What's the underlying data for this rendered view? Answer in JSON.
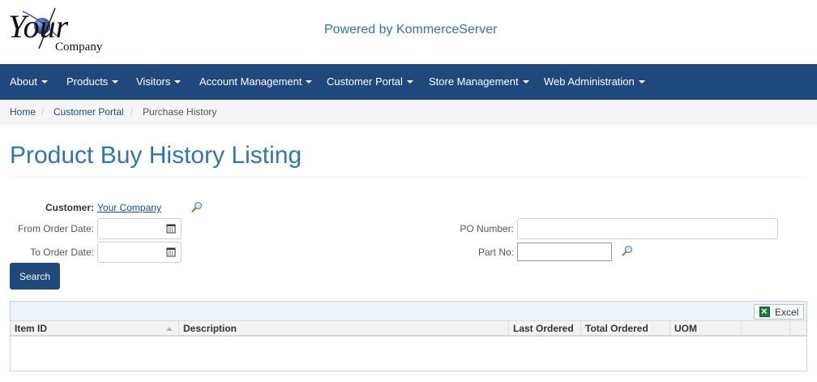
{
  "header": {
    "logo_text_main": "Your",
    "logo_text_sub": "Company",
    "powered_by": "Powered by KommerceServer"
  },
  "nav": {
    "items": [
      {
        "label": "About"
      },
      {
        "label": "Products"
      },
      {
        "label": "Visitors"
      },
      {
        "label": "Account Management"
      },
      {
        "label": "Customer Portal"
      },
      {
        "label": "Store Management"
      },
      {
        "label": "Web Administration"
      }
    ],
    "bg_color": "#1f497d"
  },
  "breadcrumb": {
    "items": [
      {
        "label": "Home"
      },
      {
        "label": "Customer Portal"
      },
      {
        "label": "Purchase History"
      }
    ],
    "separator": "/"
  },
  "page": {
    "title": "Product Buy History Listing"
  },
  "form": {
    "customer_label": "Customer:",
    "customer_value": "Your Company",
    "from_date_label": "From Order Date:",
    "from_date_value": "",
    "to_date_label": "To Order Date:",
    "to_date_value": "",
    "po_number_label": "PO Number:",
    "po_number_value": "",
    "part_no_label": "Part No:",
    "part_no_value": "",
    "search_button": "Search"
  },
  "grid": {
    "export_label": "Excel",
    "columns": [
      {
        "label": "Item ID",
        "sort": "asc"
      },
      {
        "label": "Description"
      },
      {
        "label": "Last Ordered"
      },
      {
        "label": "Total Ordered"
      },
      {
        "label": "UOM"
      },
      {
        "label": ""
      }
    ],
    "rows": []
  },
  "icons": {
    "calendar": "calendar-icon",
    "lookup": "magnifier-icon",
    "excel": "excel-icon"
  }
}
